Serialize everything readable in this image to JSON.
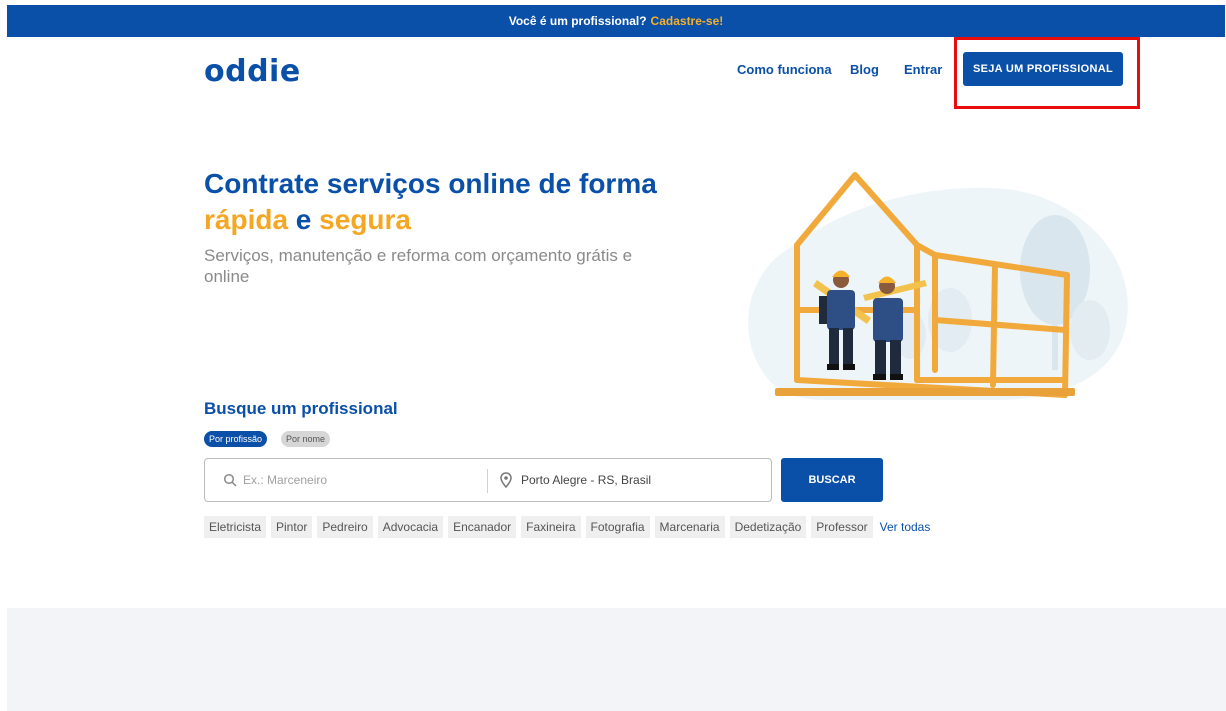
{
  "topbar": {
    "text": "Você é um profissional?",
    "link": "Cadastre-se!"
  },
  "header": {
    "logo": "oddie",
    "nav": {
      "como": "Como funciona",
      "blog": "Blog",
      "entrar": "Entrar"
    },
    "cta": "SEJA UM PROFISSIONAL"
  },
  "hero": {
    "title_line1": "Contrate serviços online de forma",
    "title_orange1": "rápida",
    "title_and": " e ",
    "title_orange2": "segura",
    "subtitle": "Serviços, manutenção e reforma com orçamento grátis e online"
  },
  "search": {
    "title": "Busque um profissional",
    "tab_profession": "Por profissão",
    "tab_name": "Por nome",
    "placeholder": "Ex.: Marceneiro",
    "location": "Porto Alegre - RS, Brasil",
    "button": "BUSCAR"
  },
  "tags": [
    "Eletricista",
    "Pintor",
    "Pedreiro",
    "Advocacia",
    "Encanador",
    "Faxineira",
    "Fotografia",
    "Marcenaria",
    "Dedetização",
    "Professor"
  ],
  "tags_more": "Ver todas",
  "colors": {
    "brand_blue": "#0a4fa8",
    "accent_orange": "#f5a623",
    "highlight_red": "#e80c0c"
  },
  "icons": {
    "search": "search-icon",
    "location": "location-pin-icon"
  }
}
